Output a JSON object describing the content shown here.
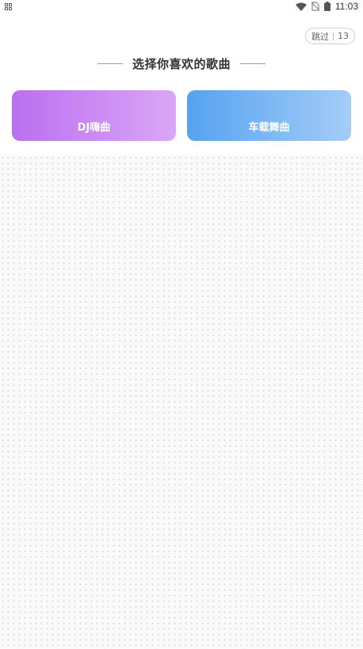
{
  "status_bar": {
    "time": "11:03",
    "icons": [
      "qr-icon",
      "wifi-icon",
      "no-sim-icon",
      "battery-icon"
    ]
  },
  "skip": {
    "label": "跳过",
    "countdown": "13"
  },
  "title": "选择你喜欢的歌曲",
  "genres": [
    {
      "label": "DJ嗨曲",
      "gradient": [
        "#bb6ff0",
        "#daa6f6"
      ]
    },
    {
      "label": "车载舞曲",
      "gradient": [
        "#56a2f0",
        "#a4cdf8"
      ]
    }
  ],
  "colors": {
    "title_text": "#333333",
    "background": "#ffffff",
    "dot_area": "#fafafa"
  }
}
